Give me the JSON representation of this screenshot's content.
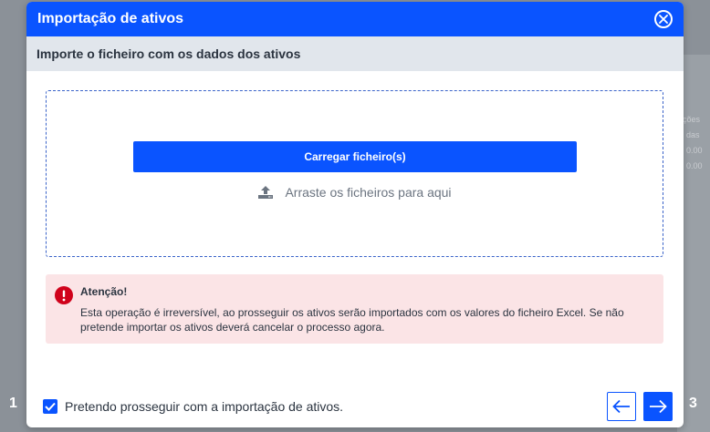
{
  "modal": {
    "title": "Importação de ativos",
    "subtitle": "Importe o ficheiro com os dados dos ativos"
  },
  "upload": {
    "button_label": "Carregar ficheiro(s)",
    "drag_text": "Arraste os ficheiros para aqui"
  },
  "alert": {
    "title": "Atenção!",
    "message": "Esta operação é irreversível, ao prosseguir os ativos serão importados com os valores do ficheiro Excel. Se não pretende importar os ativos deverá cancelar o processo agora."
  },
  "footer": {
    "checkbox_label": "Pretendo prosseguir com a importação de ativos.",
    "checkbox_checked": true
  },
  "steps": {
    "left": "1",
    "right": "3"
  },
  "background": {
    "col1": "ções",
    "col2": "das",
    "v1": "0.00",
    "v2": "0.00"
  },
  "colors": {
    "primary": "#0a54ff",
    "alert_bg": "#fbe4e6",
    "alert_icon": "#d0021b"
  },
  "icons": {
    "close": "close-circle-icon",
    "upload": "upload-icon",
    "alert": "exclamation-circle-icon",
    "prev": "arrow-left-icon",
    "next": "arrow-right-icon",
    "check": "checkmark-icon"
  }
}
